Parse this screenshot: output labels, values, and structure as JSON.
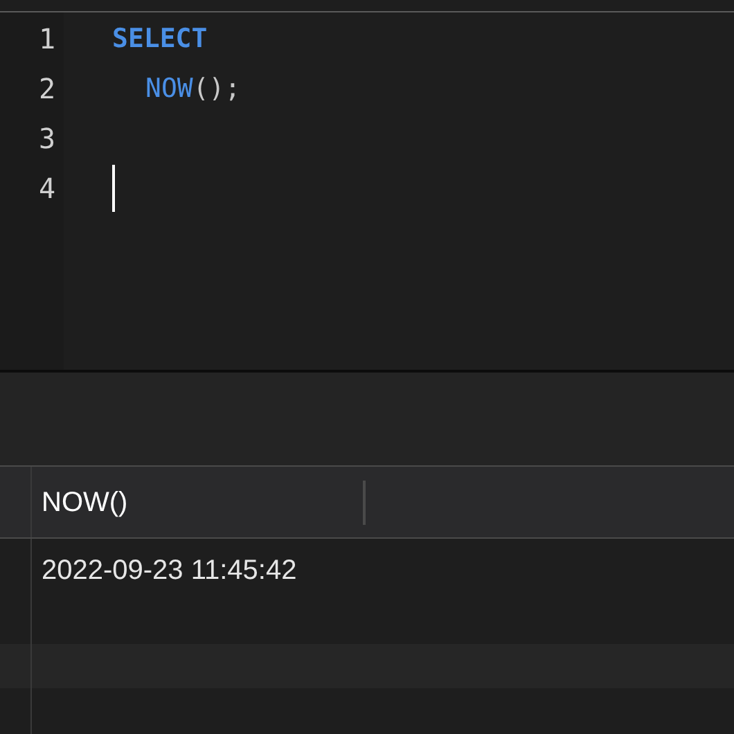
{
  "editor": {
    "lines": [
      {
        "number": "1",
        "indented": false,
        "cursor": false,
        "tokens": [
          {
            "kind": "keyword",
            "text": "SELECT"
          }
        ]
      },
      {
        "number": "2",
        "indented": true,
        "cursor": false,
        "tokens": [
          {
            "kind": "function",
            "text": "NOW"
          },
          {
            "kind": "punct",
            "text": "();"
          }
        ]
      },
      {
        "number": "3",
        "cursor": false
      },
      {
        "number": "4",
        "indented": false,
        "cursor": true
      }
    ]
  },
  "results": {
    "columns": [
      "NOW()"
    ],
    "rows": [
      [
        "2022-09-23 11:45:42"
      ]
    ]
  }
}
